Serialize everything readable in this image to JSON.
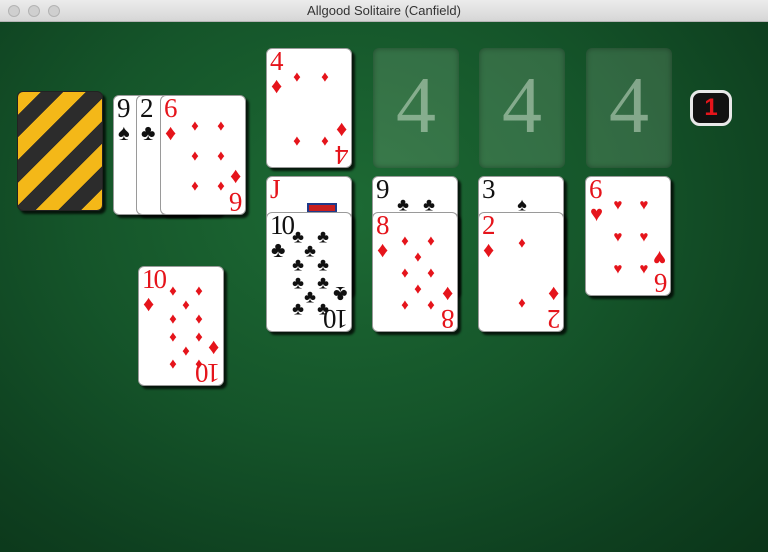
{
  "window": {
    "title": "Allgood Solitaire (Canfield)"
  },
  "stock": {
    "icon": "card-back-striped-icon"
  },
  "waste": {
    "partial_cards": [
      {
        "rank": "9",
        "suit": "♠",
        "color": "black"
      },
      {
        "rank": "2",
        "suit": "♣",
        "color": "black"
      }
    ],
    "top_card": {
      "rank": "6",
      "suit": "♦",
      "color": "red"
    }
  },
  "reserve": {
    "top_card": {
      "rank": "10",
      "suit": "♦",
      "color": "red"
    }
  },
  "foundations": [
    {
      "rank": "4",
      "suit": "♦",
      "color": "red"
    },
    {
      "placeholder": "4"
    },
    {
      "placeholder": "4"
    },
    {
      "placeholder": "4"
    }
  ],
  "tableau": [
    {
      "covered": {
        "rank": "J",
        "color": "red"
      },
      "top": {
        "rank": "10",
        "suit": "♣",
        "color": "black"
      }
    },
    {
      "covered": {
        "rank": "9",
        "suit": "♣",
        "color": "black"
      },
      "top": {
        "rank": "8",
        "suit": "♦",
        "color": "red"
      }
    },
    {
      "covered": {
        "rank": "3",
        "suit": "♠",
        "color": "black"
      },
      "top": {
        "rank": "2",
        "suit": "♦",
        "color": "red"
      }
    },
    {
      "top": {
        "rank": "6",
        "suit": "♥",
        "color": "red"
      }
    }
  ],
  "redeal_counter": "1",
  "colors": {
    "felt": "#15552a",
    "red_suit": "#e5141b",
    "badge_bg": "#111111"
  }
}
